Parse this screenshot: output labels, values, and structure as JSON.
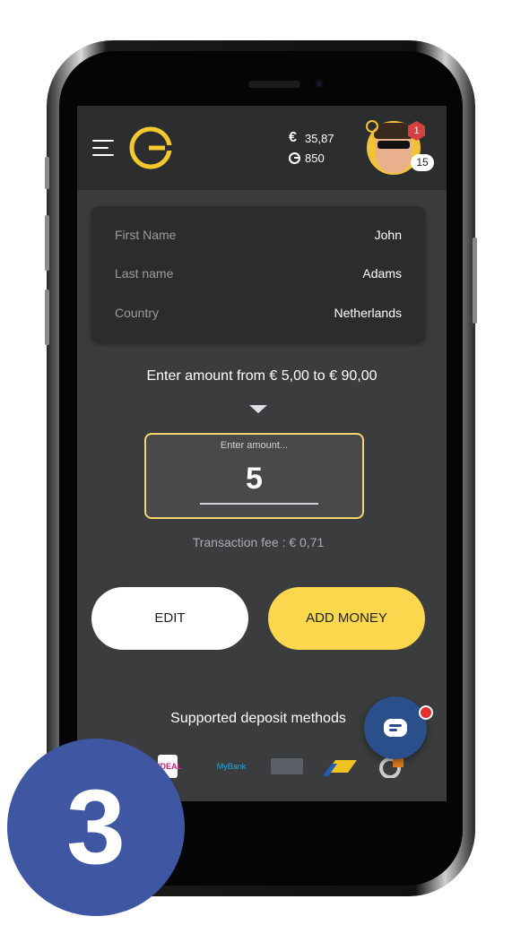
{
  "header": {
    "balance_euro": "35,87",
    "euro_symbol": "€",
    "points": "850",
    "notifications": "1",
    "level": "15"
  },
  "profile": {
    "rows": [
      {
        "label": "First Name",
        "value": "John"
      },
      {
        "label": "Last name",
        "value": "Adams"
      },
      {
        "label": "Country",
        "value": "Netherlands"
      }
    ]
  },
  "amount": {
    "prompt": "Enter amount from € 5,00 to € 90,00",
    "placeholder": "Enter amount...",
    "value": "5",
    "fee": "Transaction fee : € 0,71"
  },
  "buttons": {
    "edit": "EDIT",
    "add_money": "ADD MONEY"
  },
  "deposit": {
    "title": "Supported deposit methods",
    "methods": [
      {
        "name": "iDEAL",
        "label": "IDEAL"
      },
      {
        "name": "MyBank",
        "label": "MyBank"
      },
      {
        "name": "card",
        "label": ""
      },
      {
        "name": "bank-transfer",
        "label": ""
      },
      {
        "name": "other",
        "label": ""
      }
    ]
  },
  "step": "3",
  "colors": {
    "accent": "#fbd74e",
    "background": "#3a3c3e",
    "topbar": "#2b2d2f",
    "step_badge": "#3f57a3",
    "chat": "#2a4f8a"
  }
}
